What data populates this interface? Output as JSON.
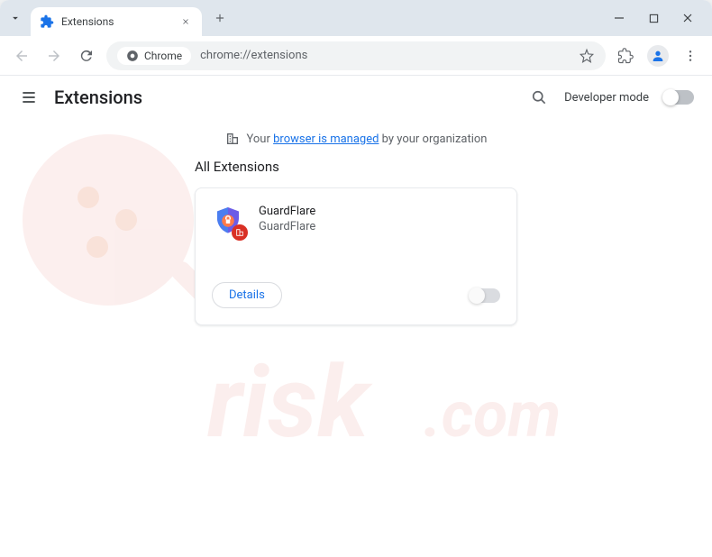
{
  "tab": {
    "title": "Extensions"
  },
  "omnibox": {
    "chip": "Chrome",
    "url": "chrome://extensions"
  },
  "header": {
    "title": "Extensions",
    "dev_mode_label": "Developer mode"
  },
  "banner": {
    "prefix": "Your ",
    "link": "browser is managed",
    "suffix": " by your organization"
  },
  "section": {
    "title": "All Extensions"
  },
  "extension": {
    "name": "GuardFlare",
    "description": "GuardFlare",
    "details_label": "Details"
  }
}
